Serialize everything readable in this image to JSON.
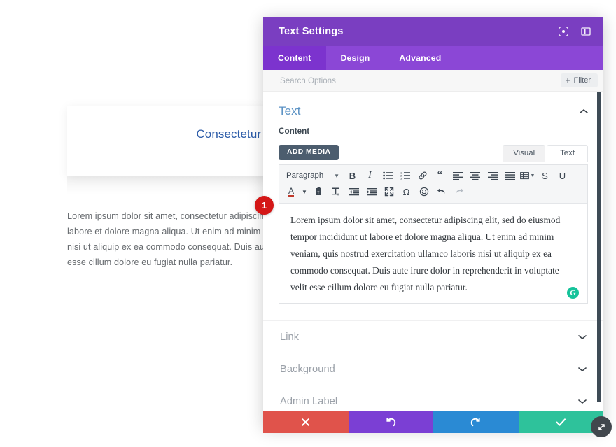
{
  "page": {
    "hero_title": "Consectetur adipiscing elit",
    "body_text": "Lorem ipsum dolor sit amet, consectetur adipiscing elit, sed do eiusmod tempor incididunt ut labore et dolore magna aliqua. Ut enim ad minim veniam, quis nostrud exercitation ullamco laboris nisi ut aliquip ex ea commodo consequat. Duis aute irure dolor in reprehenderit in voluptate velit esse cillum dolore eu fugiat nulla pariatur.",
    "hero_title_color": "#2b5ba8"
  },
  "modal": {
    "title": "Text Settings",
    "title_bar_color": "#7a3ec1",
    "tab_bar_color": "#8b47d6",
    "active_tab_color": "#7c33ce",
    "header_icons": [
      {
        "name": "focus-mode-icon"
      },
      {
        "name": "panel-layout-icon"
      }
    ],
    "tabs": [
      {
        "label": "Content",
        "active": true
      },
      {
        "label": "Design",
        "active": false
      },
      {
        "label": "Advanced",
        "active": false
      }
    ],
    "search": {
      "placeholder": "Search Options",
      "value": ""
    },
    "filter_button": {
      "label": "Filter",
      "plus": "+"
    },
    "step_badge": "1",
    "sections": {
      "text": {
        "heading": "Text",
        "expanded": true,
        "content_label": "Content",
        "add_media_label": "ADD MEDIA",
        "editor_tabs": [
          {
            "label": "Visual",
            "active": true
          },
          {
            "label": "Text",
            "active": false
          }
        ],
        "toolbar_row1": [
          {
            "name": "paragraph-format-select",
            "label": "Paragraph",
            "type": "select"
          },
          {
            "name": "bold-icon",
            "glyph": "B",
            "type": "bold"
          },
          {
            "name": "italic-icon",
            "glyph": "I",
            "type": "italic"
          },
          {
            "name": "bullet-list-icon",
            "type": "ul"
          },
          {
            "name": "numbered-list-icon",
            "type": "ol"
          },
          {
            "name": "link-icon",
            "type": "link"
          },
          {
            "name": "blockquote-icon",
            "glyph": "“",
            "type": "quote"
          },
          {
            "name": "align-left-icon",
            "type": "align-left"
          },
          {
            "name": "align-center-icon",
            "type": "align-center"
          },
          {
            "name": "align-right-icon",
            "type": "align-right"
          },
          {
            "name": "align-justify-icon",
            "type": "align-justify"
          },
          {
            "name": "table-icon",
            "type": "table"
          },
          {
            "name": "strikethrough-icon",
            "glyph": "S",
            "type": "strike"
          },
          {
            "name": "underline-icon",
            "glyph": "U",
            "type": "underline"
          }
        ],
        "toolbar_row2": [
          {
            "name": "text-color-icon",
            "glyph": "A",
            "type": "textcolor"
          },
          {
            "name": "paste-as-text-icon",
            "type": "paste"
          },
          {
            "name": "clear-formatting-icon",
            "glyph": "T",
            "type": "clearfmt"
          },
          {
            "name": "outdent-icon",
            "type": "outdent"
          },
          {
            "name": "indent-icon",
            "type": "indent"
          },
          {
            "name": "fullscreen-icon",
            "type": "fullscreen"
          },
          {
            "name": "special-character-icon",
            "glyph": "Ω",
            "type": "omega"
          },
          {
            "name": "emoji-icon",
            "type": "emoji"
          },
          {
            "name": "undo-icon",
            "type": "undo"
          },
          {
            "name": "redo-icon",
            "type": "redo",
            "disabled": true
          }
        ],
        "editor_content": "Lorem ipsum dolor sit amet, consectetur adipiscing elit, sed do eiusmod tempor incididunt ut labore et dolore magna aliqua. Ut enim ad minim veniam, quis nostrud exercitation ullamco laboris nisi ut aliquip ex ea commodo consequat. Duis aute irure dolor in reprehenderit in voluptate velit esse cillum dolore eu fugiat nulla pariatur.",
        "grammarly_glyph": "G",
        "grammarly_color": "#15c39a"
      }
    },
    "collapsed_sections": [
      {
        "label": "Link"
      },
      {
        "label": "Background"
      },
      {
        "label": "Admin Label"
      }
    ],
    "actions": [
      {
        "name": "cancel-button",
        "icon": "close-icon",
        "color": "#e0534b"
      },
      {
        "name": "undo-button",
        "icon": "undo-icon",
        "color": "#7b3fd4"
      },
      {
        "name": "redo-button",
        "icon": "redo-icon",
        "color": "#2a8ad4"
      },
      {
        "name": "save-button",
        "icon": "check-icon",
        "color": "#2ec29b"
      }
    ],
    "resize_handle": "resize-icon"
  }
}
